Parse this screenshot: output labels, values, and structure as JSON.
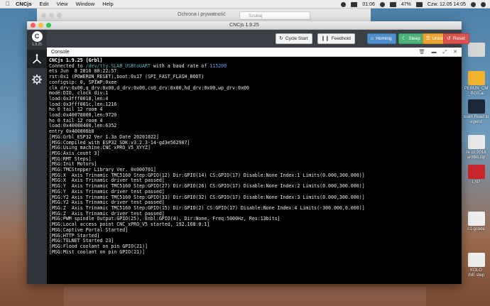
{
  "menubar": {
    "app": "CNCjs",
    "items": [
      "Edit",
      "View",
      "Window",
      "Help"
    ],
    "time": "01:06",
    "battery": "47%",
    "date": "Czw. 12.05  14:05"
  },
  "background_window": {
    "title": "Ochrona i prywatność",
    "search_placeholder": "Szukaj"
  },
  "desktop_icons": [
    {
      "label": "PERUN_CM _BOX.ai"
    },
    {
      "label": "team Road to egend"
    },
    {
      "label": "re cc 2018 amtlib.zip"
    },
    {
      "label": "LSP"
    },
    {
      "label": "n1.gcode"
    },
    {
      "label": "KOLO INE.step"
    }
  ],
  "window": {
    "title": "CNCjs 1.9.25",
    "version_badge": "1.9.25"
  },
  "toolbar": {
    "cycle_start": "Cycle Start",
    "feedhold": "Feedhold",
    "homing": "Homing",
    "sleep": "Sleep",
    "unlock": "Unlock",
    "reset": "Reset"
  },
  "console": {
    "title": "Console",
    "header_line": "CNCjs 1.9.25 [Grbl]",
    "connected_prefix": "Connected to ",
    "connected_port": "/dev/tty.SLAB_USBtoUART",
    "connected_mid": " with a baud rate of ",
    "connected_baud": "115200",
    "lines": [
      "ets Jun  8 2016 00:22:57",
      "rst:0x1 (POWERON_RESET),boot:0x17 (SPI_FAST_FLASH_BOOT)",
      "configsip: 0, SPIWP:0xee",
      "clk_drv:0x00,q_drv:0x00,d_drv:0x00,cs0_drv:0x00,hd_drv:0x00,wp_drv:0x00",
      "mode:DIO, clock div:1",
      "load:0x3fff0018,len:4",
      "load:0x3fff001c,len:1216",
      "ho 0 tail 12 room 4",
      "load:0x40078000,len:9720",
      "ho 0 tail 12 room 4",
      "load:0x40080400,len:6352",
      "entry 0x400806b8",
      "[MSG:Grbl_ESP32 Ver 1.3a Date 20201022]",
      "[MSG:Compiled with ESP32 SDK:v3.2.3-14-gd3e562907]",
      "[MSG:Using machine:CNC_xPRO_V5_XYYZ]",
      "[MSG:Axis count 3]",
      "[MSG:RMT Steps]",
      "[MSG:Init Motors]",
      "[MSG:TMCStepper Library Ver. 0x000701]",
      "[MSG:X  Axis Trinamic TMC5160 Step:GPIO(12) Dir:GPIO(14) CS:GPIO(17) Disable:None Index:1 Limits(0.000,300.000)]",
      "[MSG:X  Axis Trinamic driver test passed]",
      "[MSG:Y  Axis Trinamic TMC5160 Step:GPIO(27) Dir:GPIO(26) CS:GPIO(17) Disable:None Index:2 Limits(0.000,300.000)]",
      "[MSG:Y  Axis Trinamic driver test passed]",
      "[MSG:Y2 Axis Trinamic TMC5160 Step:GPIO(33) Dir:GPIO(32) CS:GPIO(17) Disable:None Index:3 Limits(0.000,300.000)]",
      "[MSG:Y2 Axis Trinamic driver test passed]",
      "[MSG:Z  Axis Trinamic TMC5160 Step:GPIO(15) Dir:GPIO(2) CS:GPIO(17) Disable:None Index:4 Limits(-300.000,0.000)]",
      "[MSG:Z  Axis Trinamic driver test passed]",
      "[MSG:PWM spindle Output:GPIO(25), Enbl:GPIO(4), Dir:None, Freq:5000Hz, Res:13bits]",
      "[MSG:Local access point CNC_xPRO_V5 started, 192.168.0.1]",
      "[MSG:Captive Portal Started]",
      "[MSG:HTTP Started]",
      "[MSG:TELNET Started 23]",
      "[MSG:Flood coolant on pin GPIO(21)]",
      "[MSG:Mist coolant on pin GPIO(21)]"
    ]
  },
  "colors": {
    "homing": "#4e8fcb",
    "sleep": "#4bb27a",
    "unlock": "#eba331",
    "reset": "#d9534f",
    "port_link": "#56b6c2",
    "baud": "#6c9ef8"
  },
  "icons": {
    "sidebar_active": "axes-icon",
    "sidebar_settings": "gear-icon",
    "cycle_start": "refresh-icon",
    "feedhold": "pause-icon",
    "homing": "home-icon",
    "sleep": "moon-icon",
    "unlock": "unlock-icon",
    "reset": "undo-icon",
    "console_tools": [
      "trash-icon",
      "minimize-icon",
      "expand-icon",
      "close-icon"
    ]
  }
}
